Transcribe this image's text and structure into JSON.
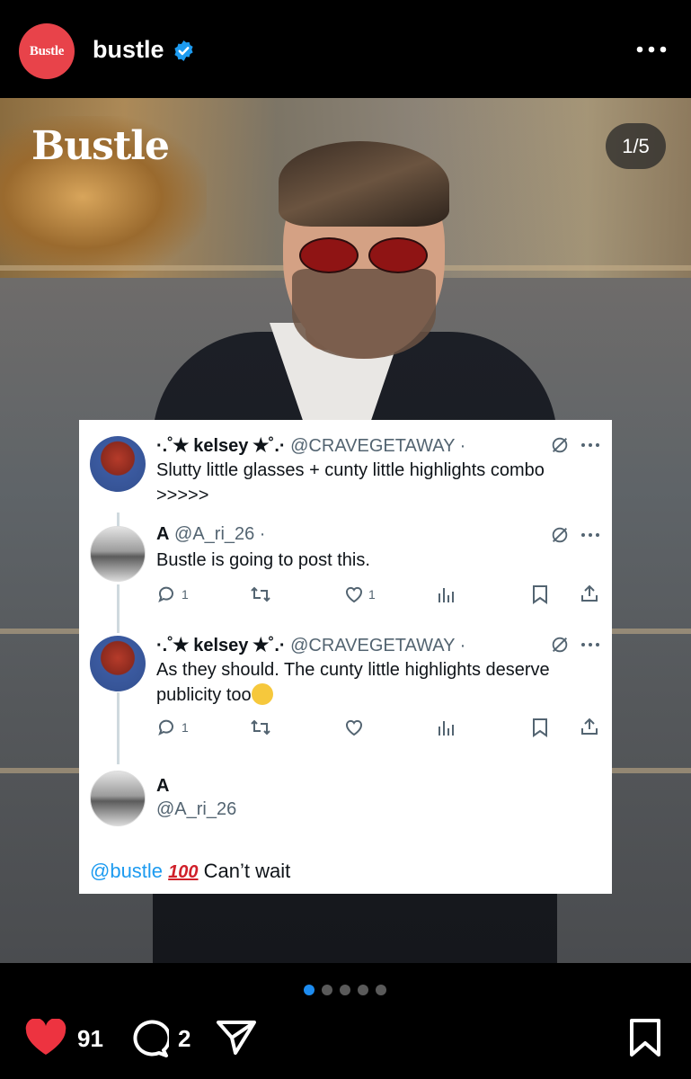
{
  "header": {
    "avatar_text": "Bustle",
    "account_name": "bustle",
    "verified_icon": "verified-badge-icon",
    "more_icon": "more-horizontal-icon",
    "brand_color": "#e8434a"
  },
  "post": {
    "watermark": "Bustle",
    "counter": "1/5",
    "tweets": [
      {
        "name": "·.˚✭ kelsey ✭˚.·",
        "handle": "@CRAVEGETAWAY ·",
        "text": "Slutty little glasses + cunty little highlights combo >>>>>"
      },
      {
        "name": "A",
        "handle": "@A_ri_26 ·",
        "text": "Bustle is going to post this.",
        "replies": "1",
        "likes": "1"
      },
      {
        "name": "·.˚✭ kelsey ✭˚.·",
        "handle": "@CRAVEGETAWAY ·",
        "text": "As they should. The cunty little highlights deserve publicity too",
        "replies": "1"
      }
    ],
    "final_reply": {
      "name": "A",
      "handle": "@A_ri_26",
      "mention": "@bustle",
      "emoji": "100",
      "text": "Can’t wait"
    }
  },
  "pager": {
    "total": 5,
    "current": 1,
    "active_color": "#1d8cf0"
  },
  "actions": {
    "likes": "91",
    "comments": "2",
    "like_color": "#ed3340"
  }
}
